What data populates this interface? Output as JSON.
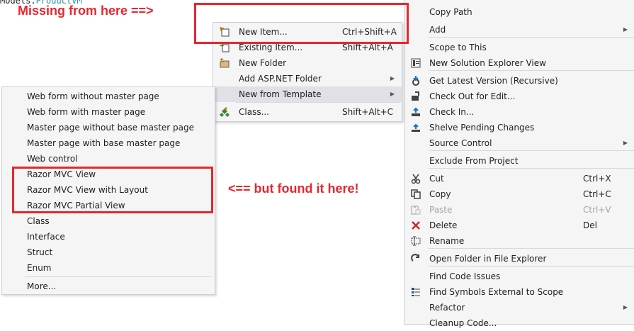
{
  "editor": {
    "code_prefix": "Models.",
    "code_type": "ProductVM"
  },
  "annotations": {
    "top": "Missing from here ==>",
    "bottom": "<== but found it here!",
    "color": "#e8262e"
  },
  "context_menu": {
    "items": [
      {
        "label": "Copy Path",
        "icon": ""
      },
      {
        "label": "Add",
        "icon": "",
        "submenu": true
      },
      {
        "label": "Scope to This",
        "icon": ""
      },
      {
        "label": "New Solution Explorer View",
        "icon": "new-explorer-view-icon"
      },
      {
        "label": "Get Latest Version (Recursive)",
        "icon": "get-latest-icon"
      },
      {
        "label": "Check Out for Edit...",
        "icon": "check-out-icon"
      },
      {
        "label": "Check In...",
        "icon": "check-in-icon"
      },
      {
        "label": "Shelve Pending Changes",
        "icon": "shelve-icon"
      },
      {
        "label": "Source Control",
        "icon": "",
        "submenu": true
      },
      {
        "label": "Exclude From Project",
        "icon": ""
      },
      {
        "label": "Cut",
        "icon": "cut-icon",
        "shortcut": "Ctrl+X"
      },
      {
        "label": "Copy",
        "icon": "copy-icon",
        "shortcut": "Ctrl+C"
      },
      {
        "label": "Paste",
        "icon": "paste-icon",
        "shortcut": "Ctrl+V",
        "disabled": true
      },
      {
        "label": "Delete",
        "icon": "delete-icon",
        "shortcut": "Del"
      },
      {
        "label": "Rename",
        "icon": "rename-icon"
      },
      {
        "label": "Open Folder in File Explorer",
        "icon": "open-folder-icon"
      },
      {
        "label": "Find Code Issues",
        "icon": ""
      },
      {
        "label": "Find Symbols External to Scope",
        "icon": "find-symbols-icon"
      },
      {
        "label": "Refactor",
        "icon": "",
        "submenu": true
      },
      {
        "label": "Cleanup Code...",
        "icon": ""
      }
    ]
  },
  "add_submenu": {
    "items": [
      {
        "label": "New Item...",
        "shortcut": "Ctrl+Shift+A",
        "icon": "new-item-icon"
      },
      {
        "label": "Existing Item...",
        "shortcut": "Shift+Alt+A",
        "icon": "existing-item-icon"
      },
      {
        "label": "New Folder",
        "shortcut": "",
        "icon": "new-folder-icon"
      },
      {
        "label": "Add ASP.NET Folder",
        "shortcut": "",
        "icon": "",
        "submenu": true
      },
      {
        "label": "New from Template",
        "shortcut": "",
        "icon": "",
        "submenu": true
      },
      {
        "label": "Class...",
        "shortcut": "Shift+Alt+C",
        "icon": "class-icon"
      }
    ]
  },
  "template_submenu": {
    "items": [
      "Web form without master page",
      "Web form with master page",
      "Master page without base master page",
      "Master page with base master page",
      "Web control",
      "Razor MVC View",
      "Razor MVC View with Layout",
      "Razor MVC Partial View",
      "Class",
      "Interface",
      "Struct",
      "Enum",
      "More..."
    ]
  }
}
